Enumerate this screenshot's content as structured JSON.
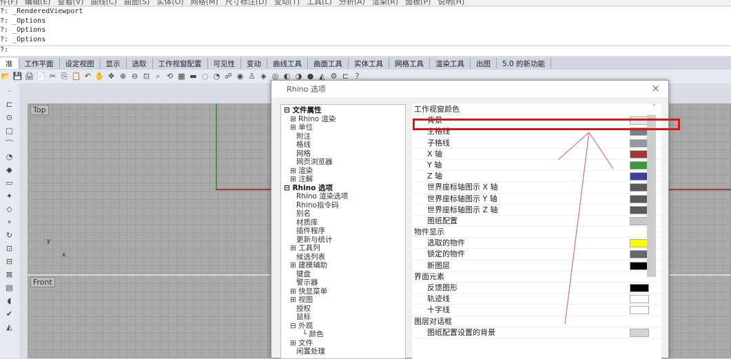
{
  "menu": [
    "件(F)",
    "编辑(E)",
    "查看(V)",
    "曲线(C)",
    "曲面(S)",
    "实体(O)",
    "网格(M)",
    "尺寸标注(D)",
    "变动(T)",
    "工具(L)",
    "分析(A)",
    "渲染(R)",
    "面板(P)",
    "说明(H)"
  ],
  "history": [
    "?: _RenderedViewport",
    "?: _Options",
    "?: _Options",
    "?: _Options"
  ],
  "prompt": "?:",
  "tabs": [
    "准",
    "工作平面",
    "设定视图",
    "显示",
    "选取",
    "工作视窗配置",
    "可见性",
    "变动",
    "曲线工具",
    "曲面工具",
    "实体工具",
    "网格工具",
    "渲染工具",
    "出图",
    "5.0 的新功能"
  ],
  "viewports": {
    "top": "Top",
    "front": "Front",
    "axis_y": "y",
    "axis_x": "x"
  },
  "dialog": {
    "title": "Rhino 选项",
    "close": "×",
    "tree": [
      {
        "t": "⊟ 文件属性",
        "b": true,
        "i": 0
      },
      {
        "t": "⊞ Rhino 渲染",
        "i": 1
      },
      {
        "t": "⊞ 单位",
        "i": 1
      },
      {
        "t": "附注",
        "i": 2
      },
      {
        "t": "格线",
        "i": 2
      },
      {
        "t": "网格",
        "i": 2
      },
      {
        "t": "网页浏览器",
        "i": 2
      },
      {
        "t": "⊞ 渲染",
        "i": 1
      },
      {
        "t": "⊞ 注解",
        "i": 1
      },
      {
        "t": "⊟ Rhino 选项",
        "b": true,
        "i": 0
      },
      {
        "t": "Rhino 渲染选项",
        "i": 2
      },
      {
        "t": "Rhino指令码",
        "i": 2
      },
      {
        "t": "别名",
        "i": 2
      },
      {
        "t": "材质库",
        "i": 2
      },
      {
        "t": "插件程序",
        "i": 2
      },
      {
        "t": "更新与统计",
        "i": 2
      },
      {
        "t": "⊞ 工具列",
        "i": 1
      },
      {
        "t": "候选列表",
        "i": 2
      },
      {
        "t": "⊞ 建模辅助",
        "i": 1
      },
      {
        "t": "键盘",
        "i": 2
      },
      {
        "t": "警示器",
        "i": 2
      },
      {
        "t": "⊞ 快显菜单",
        "i": 1
      },
      {
        "t": "⊞ 视图",
        "i": 1
      },
      {
        "t": "授权",
        "i": 2
      },
      {
        "t": "鼠标",
        "i": 2
      },
      {
        "t": "⊟ 外观",
        "i": 1
      },
      {
        "t": "└ 颜色",
        "i": 3
      },
      {
        "t": "⊞ 文件",
        "i": 1
      },
      {
        "t": "闲置处理",
        "i": 2
      }
    ],
    "rows": [
      {
        "label": "工作视窗颜色",
        "header": true
      },
      {
        "label": "背景",
        "color": "#e8e8e8"
      },
      {
        "label": "主格线",
        "color": "#7c7f88"
      },
      {
        "label": "子格线",
        "color": "#9197a0"
      },
      {
        "label": "X 轴",
        "color": "#9c3a3a"
      },
      {
        "label": "Y 轴",
        "color": "#3c9a3c"
      },
      {
        "label": "Z 轴",
        "color": "#3a3ea0"
      },
      {
        "label": "世界座标轴图示 X 轴",
        "color": "#5a5a5a"
      },
      {
        "label": "世界座标轴图示 Y 轴",
        "color": "#5a5a5a"
      },
      {
        "label": "世界座标轴图示 Z 轴",
        "color": "#5a5a5a"
      },
      {
        "label": "图纸配置",
        "color": "#c8c8c8"
      },
      {
        "label": "物件显示",
        "header": true
      },
      {
        "label": "选取的物件",
        "color": "#ffff00"
      },
      {
        "label": "锁定的物件",
        "color": "#666666"
      },
      {
        "label": "新图层",
        "color": "#000000"
      },
      {
        "label": "界面元素",
        "header": true
      },
      {
        "label": "反馈图形",
        "color": "#000000"
      },
      {
        "label": "轨迹线",
        "color": "#ffffff"
      },
      {
        "label": "十字线",
        "color": "#ffffff"
      },
      {
        "label": "图层对话框",
        "header": true
      },
      {
        "label": "图纸配置设置的背景",
        "color": "#d4d4d4"
      }
    ]
  }
}
